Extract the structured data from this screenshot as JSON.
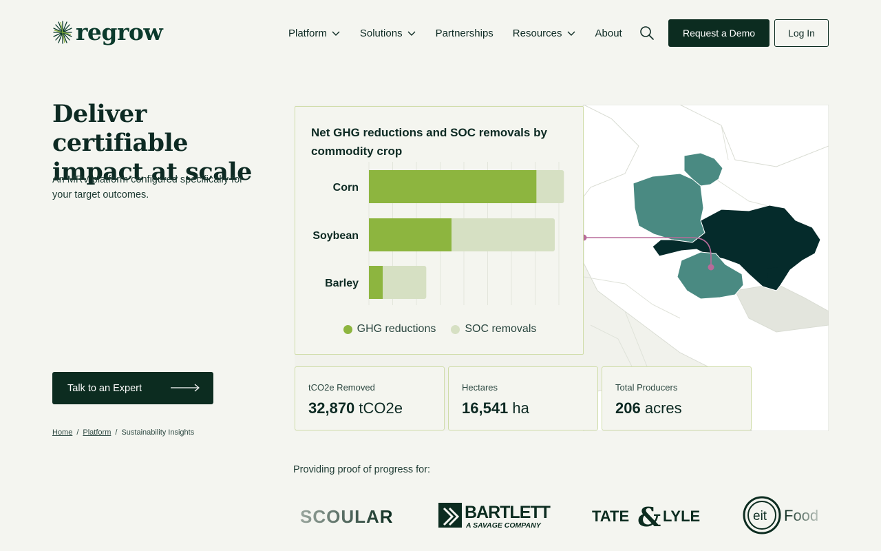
{
  "header": {
    "brand": "regrow",
    "nav": [
      {
        "label": "Platform",
        "dropdown": true
      },
      {
        "label": "Solutions",
        "dropdown": true
      },
      {
        "label": "Partnerships",
        "dropdown": false
      },
      {
        "label": "Resources",
        "dropdown": true
      },
      {
        "label": "About",
        "dropdown": false
      }
    ],
    "search_icon": "search-icon",
    "demo_button": "Request a Demo",
    "login_button": "Log In"
  },
  "hero": {
    "title_line1": "Deliver certifiable",
    "title_line2": "impact at scale",
    "subtitle": "An MRV platform configured specifically for your target outcomes.",
    "cta": "Talk to an Expert"
  },
  "breadcrumb": {
    "home": "Home",
    "separator": "/",
    "platform": "Platform",
    "current": "Sustainability Insights"
  },
  "chart_data": {
    "type": "bar",
    "orientation": "horizontal",
    "stacked": true,
    "title": "Net GHG reductions and SOC removals by commodity crop",
    "categories": [
      "Corn",
      "Soybean",
      "Barley"
    ],
    "series": [
      {
        "name": "GHG reductions",
        "color": "#8db53f",
        "values": [
          73,
          36,
          6
        ]
      },
      {
        "name": "SOC removals",
        "color": "#d6e0c3",
        "values": [
          12,
          45,
          19
        ]
      }
    ],
    "xlim": [
      0,
      87
    ],
    "grid": true,
    "legend": "bottom"
  },
  "stats": [
    {
      "label": "tCO2e Removed",
      "value": "32,870",
      "unit": "tCO2e"
    },
    {
      "label": "Hectares",
      "value": "16,541",
      "unit": "ha"
    },
    {
      "label": "Total Producers",
      "value": "206",
      "unit": "acres"
    }
  ],
  "proof": {
    "label": "Providing proof of progress for:",
    "logos": [
      {
        "name": "SCOULAR",
        "text": "SCOULAR"
      },
      {
        "name": "BARTLETT",
        "text": "BARTLETT",
        "tagline": "A SAVAGE COMPANY"
      },
      {
        "name": "TATE & LYLE",
        "text_a": "TATE",
        "text_amp": "&",
        "text_b": "LYLE"
      },
      {
        "name": "eit Food",
        "mark": "eit",
        "text": "Food"
      }
    ]
  },
  "colors": {
    "dark_green": "#0c2c20",
    "accent_green": "#8db53f",
    "light_green": "#d6e0c3",
    "map_teal": "#4a8a82",
    "map_dark": "#052b2b",
    "connector": "#b86b9a"
  }
}
